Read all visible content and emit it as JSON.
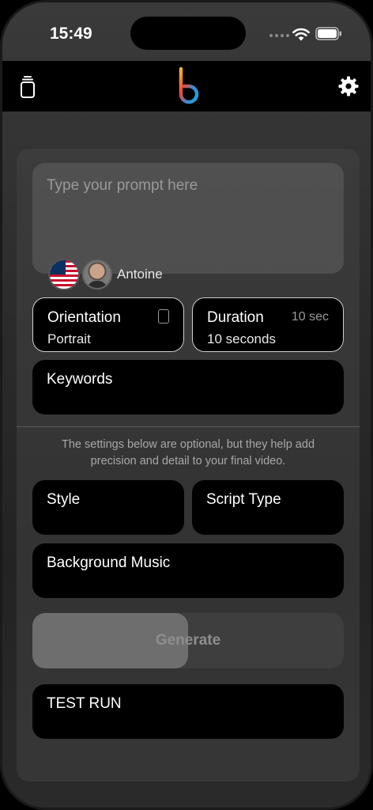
{
  "status": {
    "time": "15:49",
    "wifi_icon": "wifi-icon",
    "battery_icon": "battery-icon"
  },
  "nav": {
    "left_icon": "library-icon",
    "logo": "b",
    "right_icon": "gear-icon"
  },
  "prompt": {
    "placeholder": "Type your prompt here",
    "voice_flag": "us-flag",
    "voice_name": "Antoine"
  },
  "orientation": {
    "title": "Orientation",
    "value": "Portrait",
    "icon": "portrait-icon"
  },
  "duration": {
    "title": "Duration",
    "hint": "10 sec",
    "value": "10 seconds"
  },
  "keywords": {
    "title": "Keywords"
  },
  "optional_note": "The settings below are optional, but they help add precision and detail to your final video.",
  "style": {
    "title": "Style"
  },
  "script_type": {
    "title": "Script Type"
  },
  "background_music": {
    "title": "Background Music"
  },
  "generate": {
    "label": "Generate",
    "progress": 0.5
  },
  "test_run": {
    "title": "TEST RUN"
  },
  "colors": {
    "tile_bg": "#000000",
    "card_bg": "#464646",
    "outline": "#cfcfcf"
  }
}
